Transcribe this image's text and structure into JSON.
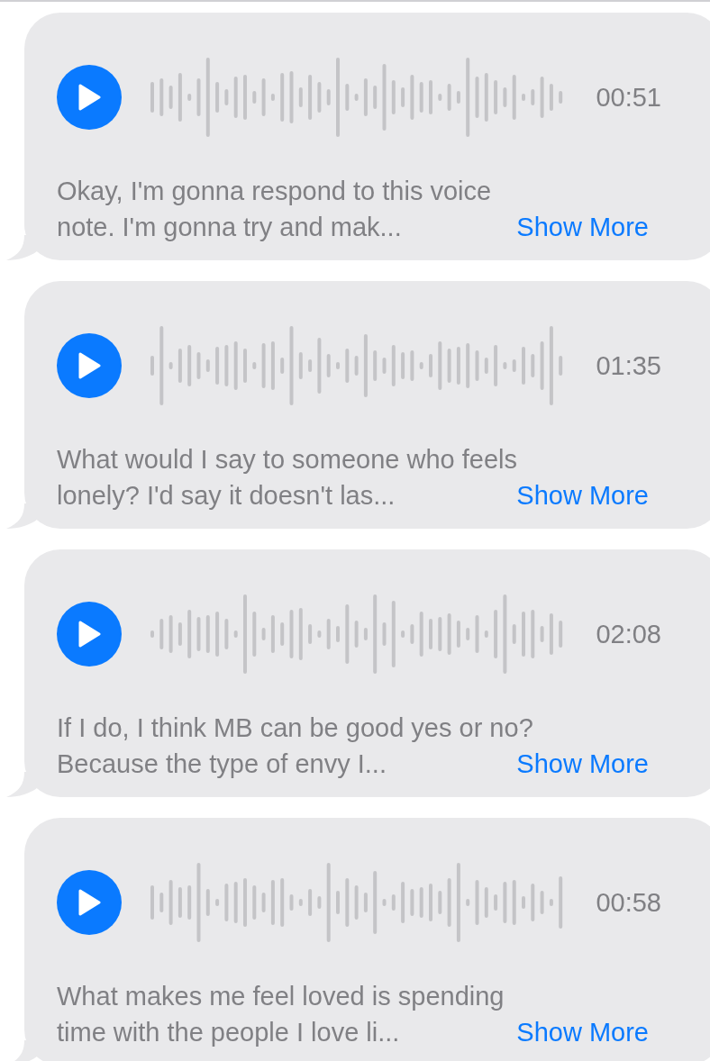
{
  "messages": [
    {
      "duration": "00:51",
      "lines": [
        "Okay, I'm gonna respond to this voice",
        "note. I'm gonna try and mak..."
      ],
      "link": "Show More"
    },
    {
      "duration": "01:35",
      "lines": [
        "What would I say to someone who feels",
        "lonely? I'd say it doesn't las..."
      ],
      "link": "Show More"
    },
    {
      "duration": "02:08",
      "lines": [
        "If I do, I think MB can be good yes or no?",
        "Because the type of envy I..."
      ],
      "link": "Show More"
    },
    {
      "duration": "00:58",
      "lines": [
        "What makes me feel loved is spending",
        "time with the people I love li..."
      ],
      "link": "Show More"
    }
  ]
}
